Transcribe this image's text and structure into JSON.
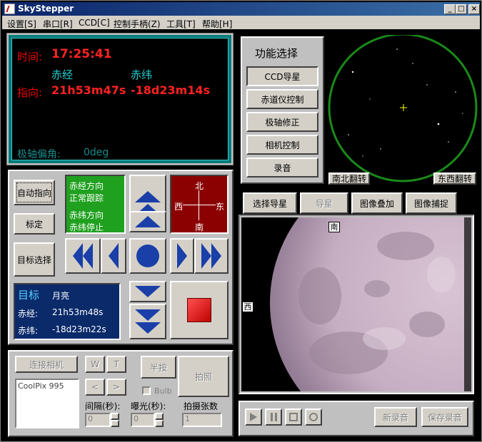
{
  "window": {
    "title": "SkyStepper",
    "min": "_",
    "max": "□",
    "close": "×"
  },
  "menu": [
    "设置[S]",
    "串口[R]",
    "CCD[C]",
    "控制手柄(Z)",
    "工具[T]",
    "帮助[H]"
  ],
  "display": {
    "time_label": "时间:",
    "time_value": "17:25:41",
    "ra_header": "赤经",
    "dec_header": "赤纬",
    "point_label": "指向:",
    "point_ra": "21h53m47s",
    "point_dec": "-18d23m14s",
    "polar_label": "极轴偏角:",
    "polar_value": "0deg"
  },
  "function": {
    "title": "功能选择",
    "buttons": [
      "CCD导星",
      "赤道仪控制",
      "极轴修正",
      "相机控制",
      "录音"
    ]
  },
  "starmap": {
    "ns_flip": "南北翻转",
    "ew_flip": "东西翻转"
  },
  "control": {
    "auto_point": "自动指向",
    "calibrate": "标定",
    "target_select": "目标选择",
    "status": {
      "ra_dir": "赤经方向",
      "ra_state": "正常跟踪",
      "dec_dir": "赤纬方向",
      "dec_state": "赤纬停止"
    },
    "compass": {
      "n": "北",
      "s": "南",
      "w": "西",
      "e": "东"
    }
  },
  "target": {
    "title": "目标",
    "name": "月亮",
    "ra_label": "赤经:",
    "ra": "21h53m48s",
    "dec_label": "赤纬:",
    "dec": "-18d23m22s"
  },
  "camera": {
    "connect": "连接相机",
    "w": "W",
    "t": "T",
    "half": "半按",
    "shoot": "拍照",
    "left": "<",
    "right": ">",
    "bulb": "Bulb",
    "device": "CoolPix 995",
    "interval_label": "间隔(秒):",
    "interval": "0",
    "exposure_label": "曝光(秒):",
    "exposure": "0",
    "count_label": "拍摄张数",
    "count": "1"
  },
  "ccd": {
    "tabs": [
      "选择导星",
      "导星",
      "图像叠加",
      "图像捕捉"
    ],
    "south": "南",
    "west": "西"
  },
  "recorder": {
    "new": "新录音",
    "save": "保存录音"
  }
}
